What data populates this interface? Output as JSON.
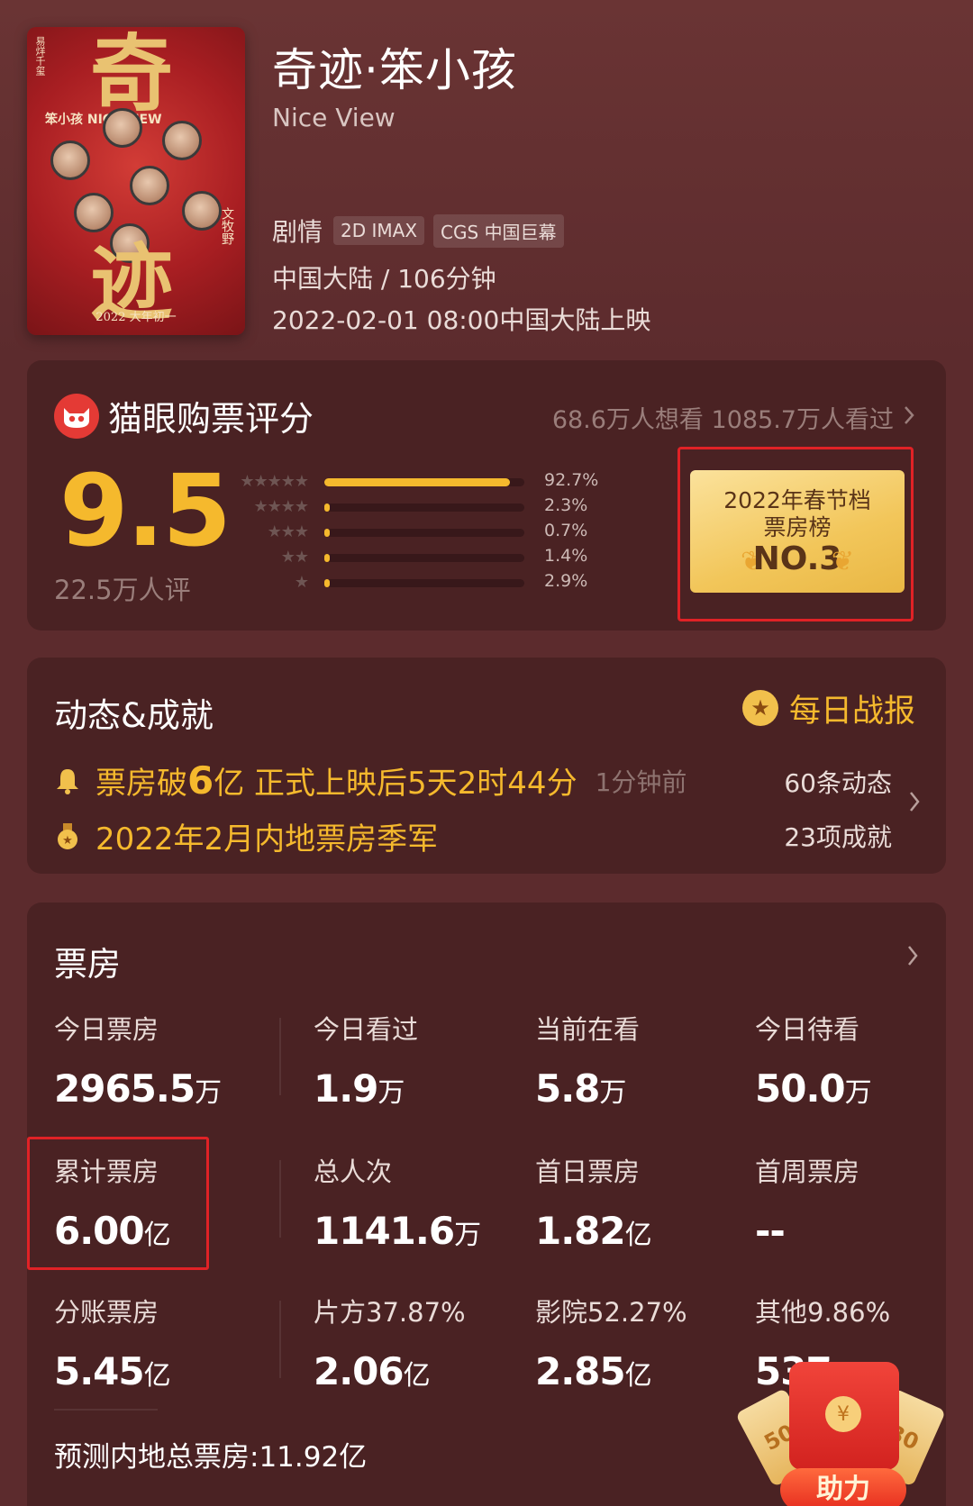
{
  "movie": {
    "title": "奇迹·笨小孩",
    "title_en": "Nice View",
    "genre": "剧情",
    "tags": [
      "2D IMAX",
      "CGS 中国巨幕"
    ],
    "region_duration": "中国大陆 / 106分钟",
    "release": "2022-02-01 08:00中国大陆上映",
    "poster": {
      "char_top": "奇",
      "char_bottom": "迹",
      "subtitle": "笨小孩 NICE VIEW",
      "date_text": "2022 大年初一",
      "side_left": "易烊千玺",
      "side_right": "文牧野"
    }
  },
  "rating": {
    "brand": "猫眼购票评分",
    "want_watch": "68.6万人想看 1085.7万人看过",
    "score": "9.5",
    "count": "22.5万人评",
    "distribution": [
      {
        "stars": "★★★★★",
        "pct_text": "92.7%",
        "pct": 92.7
      },
      {
        "stars": "★★★★",
        "pct_text": "2.3%",
        "pct": 2.3
      },
      {
        "stars": "★★★",
        "pct_text": "0.7%",
        "pct": 0.7
      },
      {
        "stars": "★★",
        "pct_text": "1.4%",
        "pct": 1.4
      },
      {
        "stars": "★",
        "pct_text": "2.9%",
        "pct": 2.9
      }
    ],
    "rank": {
      "line1": "2022年春节档",
      "line2": "票房榜",
      "no": "NO.3"
    }
  },
  "dynamics": {
    "title": "动态&成就",
    "daily_report": "每日战报",
    "item1": {
      "prefix": "票房破",
      "em": "6",
      "suffix": "亿 正式上映后5天2时44分",
      "time": "1分钟前"
    },
    "item2": "2022年2月内地票房季军",
    "count1": "60条动态",
    "count2": "23项成就"
  },
  "box_office": {
    "title": "票房",
    "stats": [
      {
        "label": "今日票房",
        "value": "2965.5",
        "unit": "万"
      },
      {
        "label": "今日看过",
        "value": "1.9",
        "unit": "万"
      },
      {
        "label": "当前在看",
        "value": "5.8",
        "unit": "万"
      },
      {
        "label": "今日待看",
        "value": "50.0",
        "unit": "万"
      },
      {
        "label": "累计票房",
        "value": "6.00",
        "unit": "亿"
      },
      {
        "label": "总人次",
        "value": "1141.6",
        "unit": "万"
      },
      {
        "label": "首日票房",
        "value": "1.82",
        "unit": "亿"
      },
      {
        "label": "首周票房",
        "value": "--",
        "unit": ""
      },
      {
        "label": "分账票房",
        "value": "5.45",
        "unit": "亿"
      },
      {
        "label": "片方37.87%",
        "value": "2.06",
        "unit": "亿"
      },
      {
        "label": "影院52.27%",
        "value": "2.85",
        "unit": "亿"
      },
      {
        "label": "其他9.86%",
        "value": "537",
        "unit": ""
      }
    ],
    "forecast": "预测内地总票房:11.92亿"
  },
  "envelope": {
    "button": "助力",
    "ticket_left": "50",
    "ticket_right": "30",
    "coin": "¥"
  }
}
